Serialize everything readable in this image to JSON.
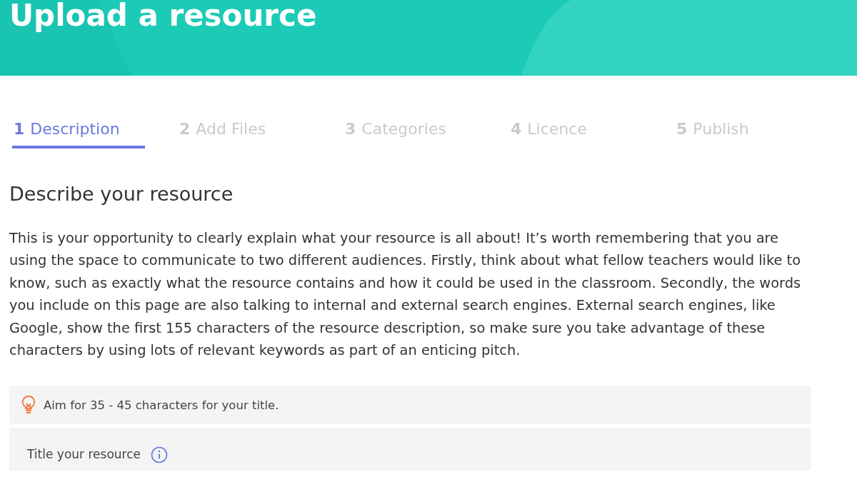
{
  "header": {
    "title": "Upload a resource"
  },
  "steps": [
    {
      "number": "1",
      "label": "Description",
      "selected": true
    },
    {
      "number": "2",
      "label": "Add Files",
      "selected": false
    },
    {
      "number": "3",
      "label": "Categories",
      "selected": false
    },
    {
      "number": "4",
      "label": "Licence",
      "selected": false
    },
    {
      "number": "5",
      "label": "Publish",
      "selected": false
    }
  ],
  "section": {
    "heading": "Describe your resource",
    "intro": "This is your opportunity to clearly explain what your resource is all about! It’s worth remembering that you are using the space to communicate to two different audiences. Firstly, think about what fellow teachers would like to know, such as exactly what the resource contains and how it could be used in the classroom. Secondly, the words you include on this page are also talking to internal and external search engines. External search engines, like Google, show the first 155 characters of the resource description, so make sure you take advantage of these characters by using lots of relevant keywords as part of an enticing pitch."
  },
  "tip": {
    "text": "Aim for 35 - 45 characters for your title."
  },
  "title_field": {
    "label": "Title your resource"
  }
}
